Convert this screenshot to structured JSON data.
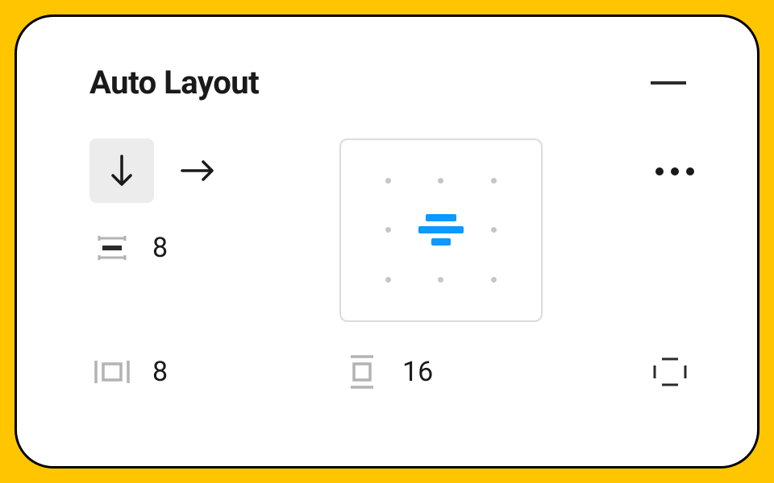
{
  "section": {
    "title": "Auto Layout"
  },
  "direction": {
    "vertical_selected": true,
    "horizontal_selected": false
  },
  "spacing": {
    "item_spacing": "8"
  },
  "padding": {
    "horizontal": "8",
    "vertical": "16"
  },
  "alignment": {
    "selected": "center"
  },
  "colors": {
    "accent": "#0d99ff",
    "panel_border": "#000000",
    "background": "#ffc600"
  }
}
